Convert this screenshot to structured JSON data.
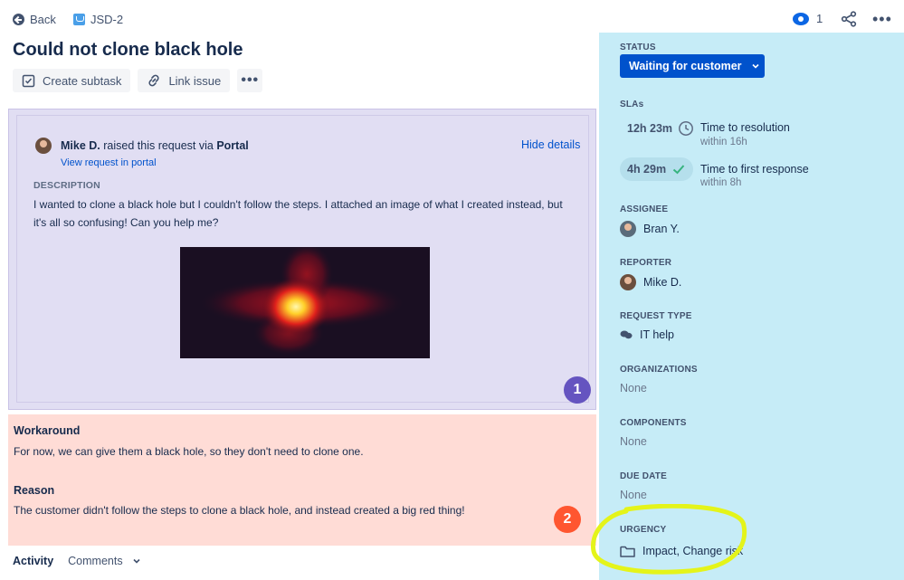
{
  "topbar": {
    "back_label": "Back",
    "issue_key": "JSD-2",
    "watch_count": "1"
  },
  "issue": {
    "title": "Could not clone black hole"
  },
  "toolbar": {
    "create_subtask": "Create subtask",
    "link_issue": "Link issue"
  },
  "details": {
    "reporter_name": "Mike D.",
    "raised_text": "raised this request via",
    "channel": "Portal",
    "view_request": "View request in portal",
    "hide_details": "Hide details",
    "description_heading": "DESCRIPTION",
    "description_text": "I wanted to clone a black hole but I couldn't follow the steps. I attached an image of what I created instead, but it's all so confusing! Can you help me?",
    "badge": "1"
  },
  "workaround": {
    "workaround_heading": "Workaround",
    "workaround_text": "For now, we can give them a black hole, so they don't need to clone one.",
    "reason_heading": "Reason",
    "reason_text": "The customer didn't follow the steps to clone a black hole, and instead created a big red thing!",
    "badge": "2"
  },
  "activity": {
    "activity_label": "Activity",
    "comments_label": "Comments"
  },
  "sidebar": {
    "status_label": "STATUS",
    "status_value": "Waiting for customer",
    "slas_label": "SLAs",
    "slas": [
      {
        "time": "12h 23m",
        "name": "Time to resolution",
        "sub": "within 16h",
        "icon": "clock-icon"
      },
      {
        "time": "4h 29m",
        "name": "Time to first response",
        "sub": "within 8h",
        "icon": "check-icon"
      }
    ],
    "assignee_label": "ASSIGNEE",
    "assignee_value": "Bran Y.",
    "reporter_label": "REPORTER",
    "reporter_value": "Mike D.",
    "request_type_label": "REQUEST TYPE",
    "request_type_value": "IT help",
    "organizations_label": "ORGANIZATIONS",
    "organizations_value": "None",
    "components_label": "COMPONENTS",
    "components_value": "None",
    "due_date_label": "DUE DATE",
    "due_date_value": "None",
    "urgency_label": "URGENCY",
    "urgency_value": "Impact, Change risk"
  },
  "colors": {
    "accent": "#0052cc",
    "details_bg": "#e1def3",
    "workaround_bg": "#ffdcd6",
    "sidebar_bg": "#c6ecf7",
    "highlight": "#e4f41a"
  }
}
